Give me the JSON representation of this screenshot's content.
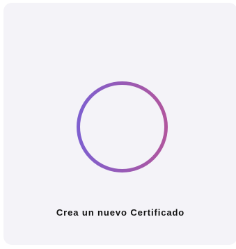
{
  "card": {
    "label": "Crea un nuevo Certificado",
    "icon": "add-circle-icon"
  },
  "colors": {
    "card_background": "#f4f3f8",
    "icon_gradient_start": "#7e5fcf",
    "icon_gradient_end": "#b0569e",
    "label_text": "#111111"
  }
}
